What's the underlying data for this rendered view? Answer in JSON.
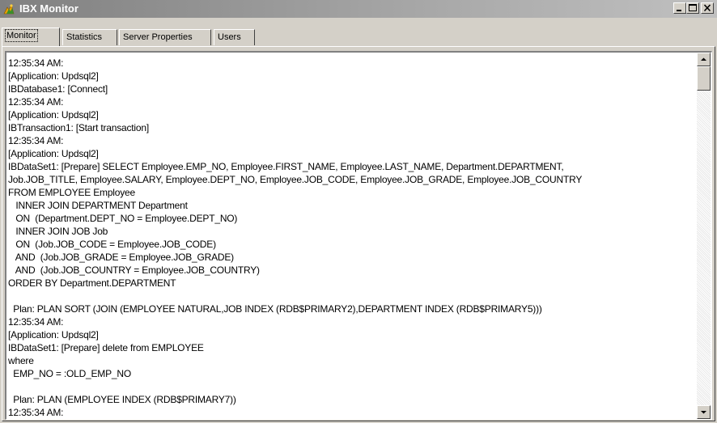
{
  "window": {
    "title": "IBX Monitor",
    "icon": "ibx-app-icon",
    "controls": [
      "minimize-icon",
      "maximize-icon",
      "close-icon"
    ]
  },
  "tabs": [
    {
      "label": "Monitor",
      "active": true
    },
    {
      "label": "Statistics",
      "active": false
    },
    {
      "label": "Server Properties",
      "active": false
    },
    {
      "label": "Users",
      "active": false
    }
  ],
  "log": {
    "lines": [
      "12:35:34 AM:",
      "[Application: Updsql2]",
      "IBDatabase1: [Connect]",
      "12:35:34 AM:",
      "[Application: Updsql2]",
      "IBTransaction1: [Start transaction]",
      "12:35:34 AM:",
      "[Application: Updsql2]",
      "IBDataSet1: [Prepare] SELECT Employee.EMP_NO, Employee.FIRST_NAME, Employee.LAST_NAME, Department.DEPARTMENT,",
      "Job.JOB_TITLE, Employee.SALARY, Employee.DEPT_NO, Employee.JOB_CODE, Employee.JOB_GRADE, Employee.JOB_COUNTRY",
      "FROM EMPLOYEE Employee",
      "   INNER JOIN DEPARTMENT Department",
      "   ON  (Department.DEPT_NO = Employee.DEPT_NO)",
      "   INNER JOIN JOB Job",
      "   ON  (Job.JOB_CODE = Employee.JOB_CODE)",
      "   AND  (Job.JOB_GRADE = Employee.JOB_GRADE)",
      "   AND  (Job.JOB_COUNTRY = Employee.JOB_COUNTRY)",
      "ORDER BY Department.DEPARTMENT",
      "",
      "  Plan: PLAN SORT (JOIN (EMPLOYEE NATURAL,JOB INDEX (RDB$PRIMARY2),DEPARTMENT INDEX (RDB$PRIMARY5)))",
      "12:35:34 AM:",
      "[Application: Updsql2]",
      "IBDataSet1: [Prepare] delete from EMPLOYEE",
      "where",
      "  EMP_NO = :OLD_EMP_NO",
      "",
      "  Plan: PLAN (EMPLOYEE INDEX (RDB$PRIMARY7))",
      "12:35:34 AM:"
    ]
  },
  "scrollbar": {
    "up_icon": "scroll-up-arrow-icon",
    "down_icon": "scroll-down-arrow-icon",
    "position": 0.0
  }
}
